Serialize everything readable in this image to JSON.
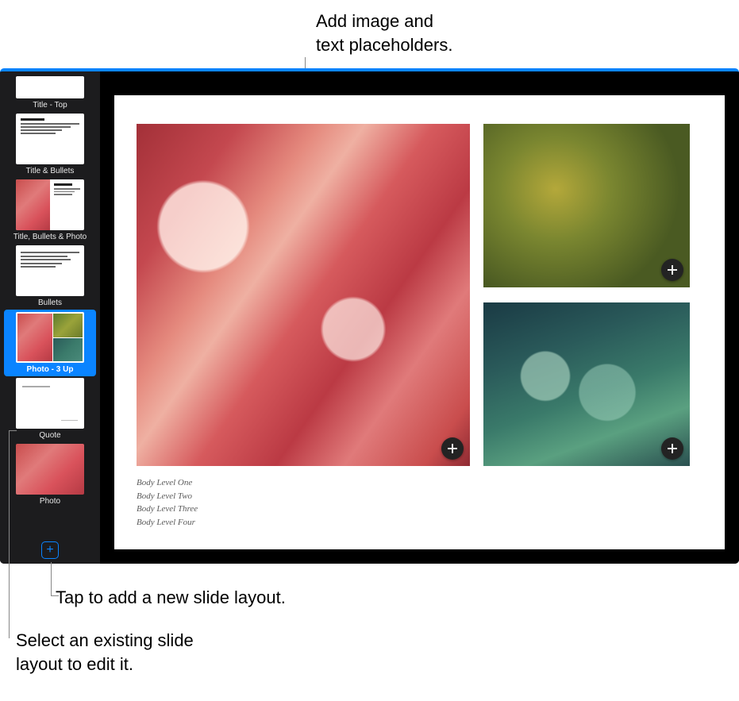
{
  "callouts": {
    "top": "Add image and\ntext placeholders.",
    "add_layout": "Tap to add a new slide layout.",
    "select_layout": "Select an existing slide\nlayout to edit it."
  },
  "sidebar": {
    "items": [
      {
        "label": "Title - Top"
      },
      {
        "label": "Title & Bullets"
      },
      {
        "label": "Title, Bullets & Photo"
      },
      {
        "label": "Bullets"
      },
      {
        "label": "Photo - 3 Up"
      },
      {
        "label": "Quote"
      },
      {
        "label": "Photo"
      }
    ],
    "selected_index": 4
  },
  "slide": {
    "body_levels": [
      "Body Level One",
      "Body Level Two",
      "Body Level Three",
      "Body Level Four"
    ]
  },
  "icons": {
    "plus": "+"
  },
  "colors": {
    "accent": "#0a84ff"
  }
}
